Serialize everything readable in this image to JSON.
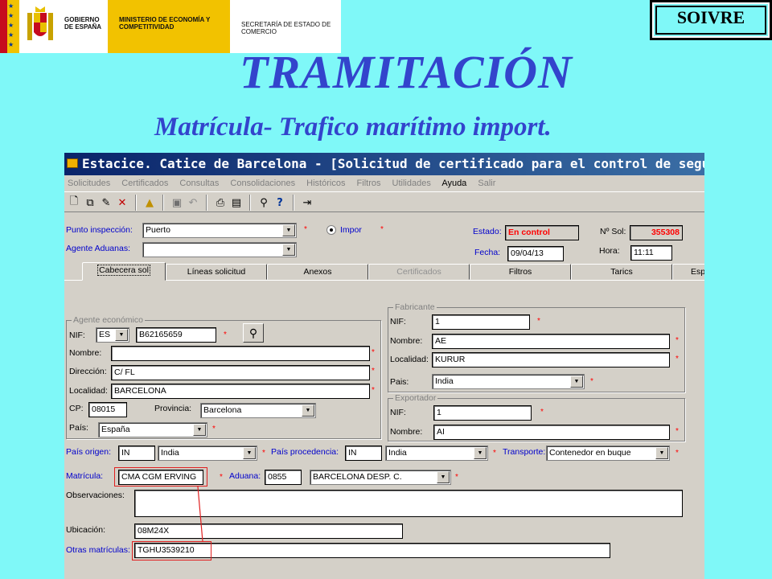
{
  "header": {
    "government": "GOBIERNO DE ESPAÑA",
    "ministry": "MINISTERIO DE ECONOMÍA Y COMPETITIVIDAD",
    "secretariat": "SECRETARÍA DE ESTADO DE COMERCIO",
    "soivre_label": "SOIVRE",
    "title": "TRAMITACIÓN",
    "subtitle": "Matrícula- Trafico marítimo import."
  },
  "window": {
    "title": "Estacice. Catice de Barcelona - [Solicitud de certificado para el control de seguridad d",
    "menu": [
      "Solicitudes",
      "Certificados",
      "Consultas",
      "Consolidaciones",
      "Históricos",
      "Filtros",
      "Utilidades",
      "Ayuda",
      "Salir"
    ]
  },
  "top": {
    "punto_label": "Punto inspección:",
    "punto_value": "Puerto",
    "impor_label": "Impor",
    "agente_label": "Agente Aduanas:",
    "agente_value": "",
    "estado_label": "Estado:",
    "estado_value": "En control",
    "nsol_label": "Nº Sol:",
    "nsol_value": "355308",
    "fecha_label": "Fecha:",
    "fecha_value": "09/04/13",
    "hora_label": "Hora:",
    "hora_value": "11:11"
  },
  "tabs": [
    "Cabecera sol",
    "Líneas solicitud",
    "Anexos",
    "Certificados",
    "Filtros",
    "Tarics",
    "Esp"
  ],
  "agente": {
    "group": "Agente económico",
    "nif_label": "NIF:",
    "nif_country": "ES",
    "nif_value": "B62165659",
    "nombre_label": "Nombre:",
    "nombre_value": "",
    "direccion_label": "Dirección:",
    "direccion_value": "C/ FL",
    "localidad_label": "Localidad:",
    "localidad_value": "BARCELONA",
    "cp_label": "CP:",
    "cp_value": "08015",
    "provincia_label": "Provincia:",
    "provincia_value": "Barcelona",
    "pais_label": "País:",
    "pais_value": "España"
  },
  "fabricante": {
    "group": "Fabricante",
    "nif_label": "NIF:",
    "nif_value": "1",
    "nombre_label": "Nombre:",
    "nombre_value": "AE",
    "localidad_label": "Localidad:",
    "localidad_value": "KURUR",
    "pais_label": "Pais:",
    "pais_value": "India"
  },
  "exportador": {
    "group": "Exportador",
    "nif_label": "NIF:",
    "nif_value": "1",
    "nombre_label": "Nombre:",
    "nombre_value": "AI"
  },
  "transport": {
    "origen_label": "País origen:",
    "origen_code": "IN",
    "origen_value": "India",
    "procedencia_label": "País procedencia:",
    "procedencia_code": "IN",
    "procedencia_value": "India",
    "transporte_label": "Transporte:",
    "transporte_value": "Contenedor en buque",
    "matricula_label": "Matrícula:",
    "matricula_value": "CMA CGM ERVING",
    "aduana_label": "Aduana:",
    "aduana_code": "0855",
    "aduana_value": "BARCELONA DESP. C.",
    "observaciones_label": "Observaciones:",
    "observaciones_value": "",
    "ubicacion_label": "Ubicación:",
    "ubicacion_value": "08M24X",
    "otras_label": "Otras matrículas:",
    "otras_value": "TGHU3539210"
  },
  "colors": {
    "background": "#7ff8f8",
    "title": "#3344cc",
    "highlight": "#e02020"
  }
}
